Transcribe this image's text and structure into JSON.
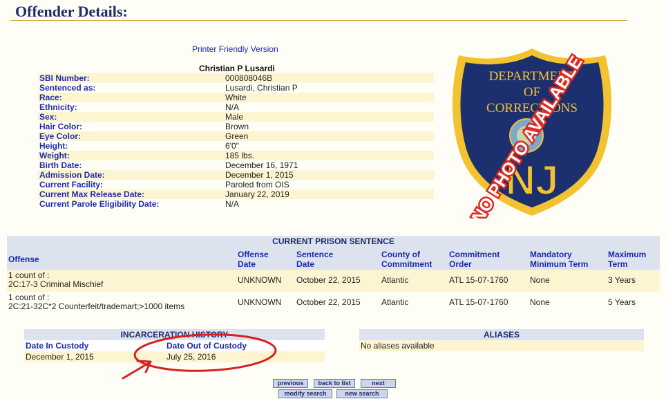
{
  "page": {
    "title": "Offender Details:",
    "printer_link": "Printer Friendly Version"
  },
  "offender": {
    "name": "Christian P Lusardi",
    "fields": [
      {
        "label": "SBI Number:",
        "value": "000808046B"
      },
      {
        "label": "Sentenced as:",
        "value": "Lusardi, Christian P"
      },
      {
        "label": "Race:",
        "value": "White"
      },
      {
        "label": "Ethnicity:",
        "value": "N/A"
      },
      {
        "label": "Sex:",
        "value": "Male"
      },
      {
        "label": "Hair Color:",
        "value": "Brown"
      },
      {
        "label": "Eye Color:",
        "value": "Green"
      },
      {
        "label": "Height:",
        "value": "6'0\""
      },
      {
        "label": "Weight:",
        "value": "185 lbs."
      },
      {
        "label": "Birth Date:",
        "value": "December 16, 1971"
      },
      {
        "label": "Admission Date:",
        "value": "December 1, 2015"
      },
      {
        "label": "Current Facility:",
        "value": "Paroled from OIS"
      },
      {
        "label": "Current Max Release Date:",
        "value": "January 22, 2019"
      },
      {
        "label": "Current Parole Eligibility Date:",
        "value": "N/A"
      }
    ]
  },
  "badge": {
    "line1": "DEPARTMENT",
    "line2": "OF",
    "line3": "CORRECTIONS",
    "initials": "NJ",
    "overlay": "NO PHOTO AVAILABLE",
    "colors": {
      "navy": "#1c2f6e",
      "gold": "#f2c230",
      "red": "#e0281e"
    }
  },
  "prison": {
    "title": "CURRENT PRISON SENTENCE",
    "headers": {
      "offense": "Offense",
      "offense_date_1": "Offense",
      "offense_date_2": "Date",
      "sentence_date_1": "Sentence",
      "sentence_date_2": "Date",
      "county_1": "County of",
      "county_2": "Commitment",
      "order_1": "Commitment",
      "order_2": "Order",
      "mandatory_1": "Mandatory",
      "mandatory_2": "Minimum Term",
      "maximum_1": "Maximum",
      "maximum_2": "Term"
    },
    "rows": [
      {
        "count": "1 count of :",
        "offense": "2C:17-3 Criminal Mischief",
        "offense_date": "UNKNOWN",
        "sentence_date": "October 22, 2015",
        "county": "Atlantic",
        "order": "ATL 15-07-1760",
        "mandatory": "None",
        "maximum": "3 Years"
      },
      {
        "count": "1 count of :",
        "offense": "2C:21-32C*2 Counterfeit/trademart;>1000 items",
        "offense_date": "UNKNOWN",
        "sentence_date": "October 22, 2015",
        "county": "Atlantic",
        "order": "ATL 15-07-1760",
        "mandatory": "None",
        "maximum": "5 Years"
      }
    ]
  },
  "incarceration": {
    "title": "INCARCERATION HISTORY",
    "in_header": "Date In Custody",
    "out_header": "Date Out of Custody",
    "in_value": "December 1, 2015",
    "out_value": "July 25, 2016"
  },
  "aliases": {
    "title": "ALIASES",
    "text": "No aliases available"
  },
  "nav": {
    "previous": "previous",
    "back": "back to list",
    "next": "next",
    "modify": "modify search",
    "new": "new search"
  },
  "annotation_color": "#d8201c"
}
